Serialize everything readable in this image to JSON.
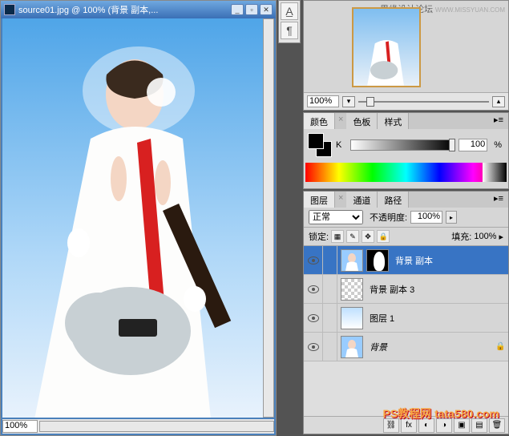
{
  "document": {
    "title": "source01.jpg @ 100% (背景 副本,...",
    "zoom": "100%"
  },
  "navigator": {
    "brand_text": "思缘设计论坛",
    "brand_url": "WWW.MISSYUAN.COM",
    "zoom": "100%"
  },
  "color": {
    "tabs": {
      "color": "颜色",
      "swatches": "色板",
      "styles": "样式"
    },
    "channel_label": "K",
    "value": "100",
    "pct": "%"
  },
  "layers": {
    "tabs": {
      "layers": "图层",
      "channels": "通道",
      "paths": "路径"
    },
    "blend_mode": "正常",
    "opacity_label": "不透明度:",
    "opacity_value": "100%",
    "lock_label": "锁定:",
    "fill_label": "填充:",
    "fill_value": "100%",
    "items": [
      {
        "name": "背景 副本",
        "visible": true,
        "selected": true,
        "has_mask": true,
        "thumb": "photo"
      },
      {
        "name": "背景 副本 3",
        "visible": true,
        "selected": false,
        "thumb": "checker"
      },
      {
        "name": "图层 1",
        "visible": true,
        "selected": false,
        "thumb": "grad"
      },
      {
        "name": "背景",
        "visible": true,
        "selected": false,
        "thumb": "photo",
        "locked": true,
        "bg": true
      }
    ]
  },
  "watermark": "PS教程网 tata580.com"
}
